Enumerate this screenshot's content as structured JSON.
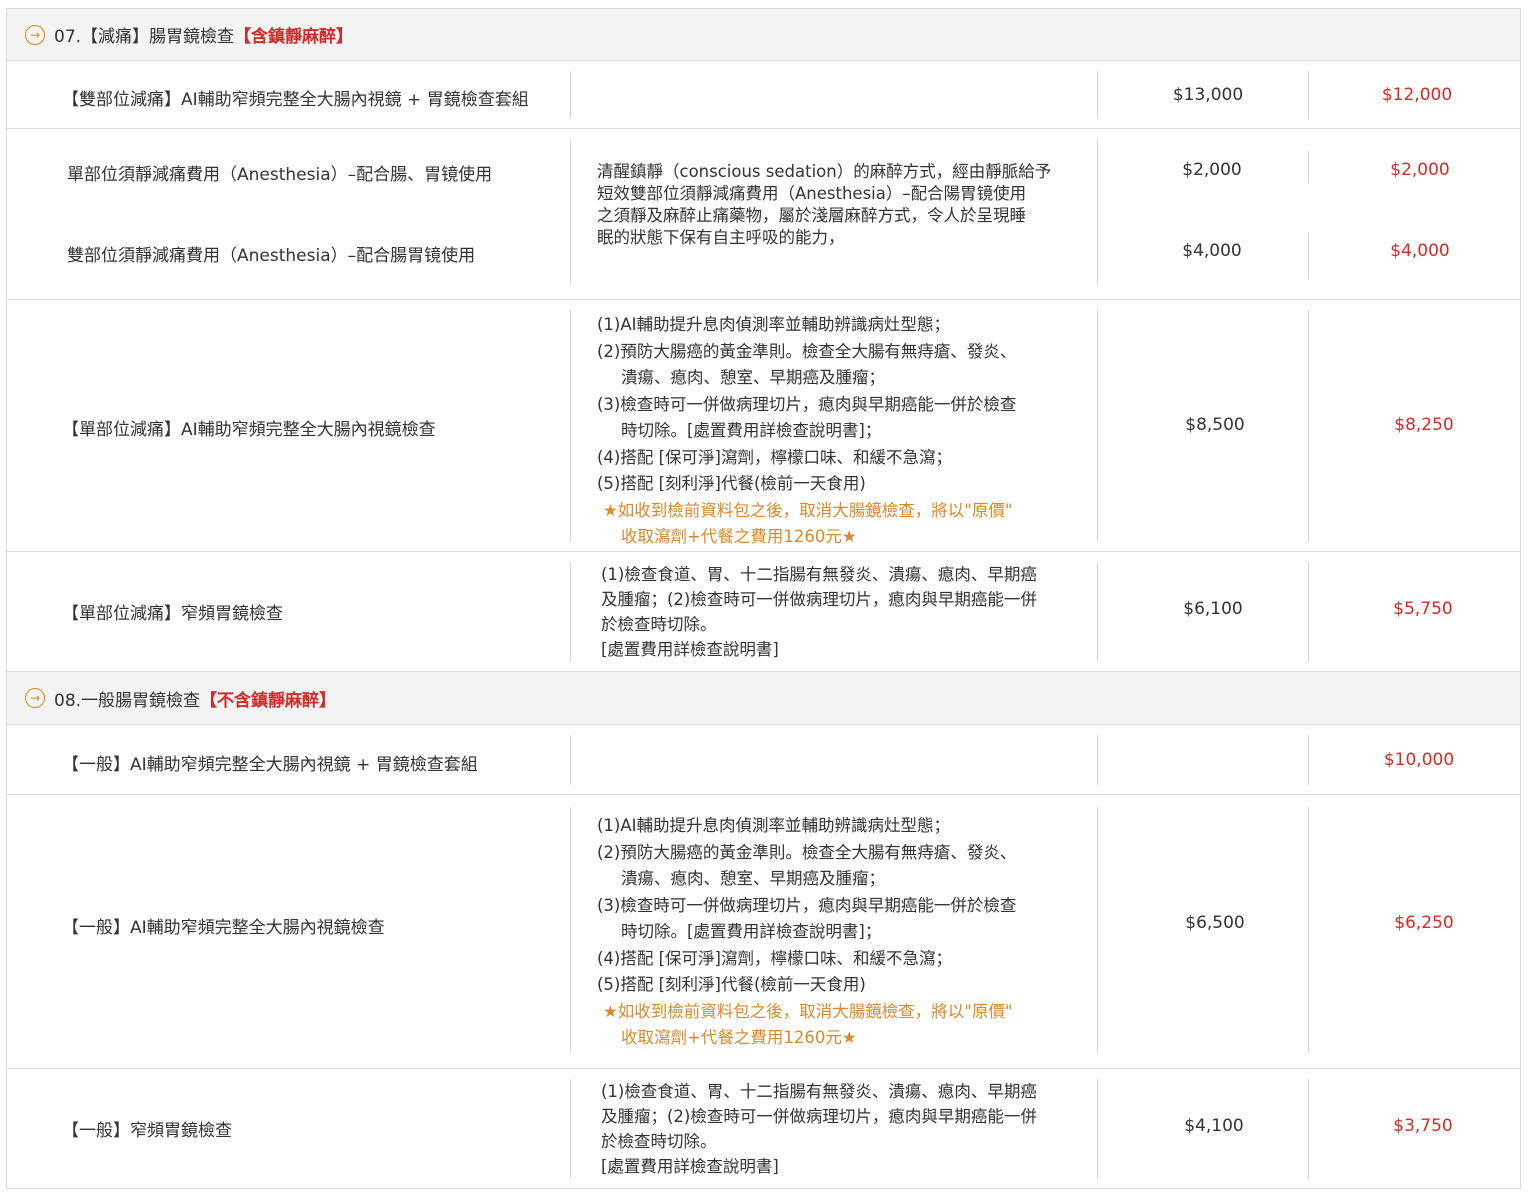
{
  "sections": [
    {
      "icon": "arrow-circle-right-icon",
      "arrow_glyph": "→",
      "title": "07.【減痛】腸胃鏡檢查",
      "highlight": "【含鎮靜麻醉】",
      "rows": [
        {
          "name": "【雙部位減痛】AI輔助窄頻完整全大腸內視鏡 + 胃鏡檢查套組",
          "price": "$13,000",
          "sale": "$12,000"
        },
        {
          "name1": "單部位須靜減痛費用（Anesthesia）–配合腸、胃镜使用",
          "name2": "雙部位須靜減痛費用（Anesthesia）–配合腸胃镜使用",
          "desc": [
            "清醒鎮靜（conscious sedation）的麻醉方式，經由靜脈給予",
            "短效雙部位須靜減痛費用（Anesthesia）–配合陽胃镜使用",
            "之須靜及麻醉止痛藥物，屬於淺層麻醉方式，令人於呈現睡",
            "眠的狀態下保有自主呼吸的能力，"
          ],
          "price1": "$2,000",
          "sale1": "$2,000",
          "price2": "$4,000",
          "sale2": "$4,000"
        },
        {
          "name": "【單部位減痛】AI輔助窄頻完整全大腸內視鏡檢查",
          "desc": [
            "(1)AI輔助提升息肉偵測率並輔助辨識病灶型態；",
            "(2)預防大腸癌的黃金準則。檢查全大腸有無痔瘡、發炎、",
            "潰瘍、瘜肉、憩室、早期癌及腫瘤；",
            "(3)檢查時可一併做病理切片，瘜肉與早期癌能一併於檢查",
            "時切除。[處置費用詳檢查說明書]；",
            "(4)搭配 [保可淨]瀉劑，檸檬口味、和緩不急瀉；",
            "(5)搭配 [刻利淨]代餐(檢前一天食用)",
            "★如收到檢前資料包之後，取消大腸鏡檢查，將以\"原價\"",
            "收取瀉劑+代餐之費用1260元★"
          ],
          "price": "$8,500",
          "sale": "$8,250"
        },
        {
          "name": "【單部位減痛】窄頻胃鏡檢查",
          "desc": [
            "(1)檢查食道、胃、十二指腸有無發炎、潰瘍、瘜肉、早期癌",
            "及腫瘤；(2)檢查時可一併做病理切片，瘜肉與早期癌能一併",
            "於檢查時切除。",
            "[處置費用詳檢查說明書]"
          ],
          "price": "$6,100",
          "sale": "$5,750"
        }
      ]
    },
    {
      "icon": "arrow-circle-right-icon",
      "arrow_glyph": "→",
      "title": "08.一般腸胃鏡檢查",
      "highlight": "【不含鎮靜麻醉】",
      "rows": [
        {
          "name": "【一般】AI輔助窄頻完整全大腸內視鏡 + 胃鏡檢查套組",
          "price": "",
          "sale": "$10,000"
        },
        {
          "name": "【一般】AI輔助窄頻完整全大腸內視鏡檢查",
          "desc": [
            "(1)AI輔助提升息肉偵測率並輔助辨識病灶型態；",
            "(2)預防大腸癌的黃金準則。檢查全大腸有無痔瘡、發炎、",
            "潰瘍、瘜肉、憩室、早期癌及腫瘤；",
            "(3)檢查時可一併做病理切片，瘜肉與早期癌能一併於檢查",
            "時切除。[處置費用詳檢查說明書]；",
            "(4)搭配 [保可淨]瀉劑，檸檬口味、和緩不急瀉；",
            "(5)搭配 [刻利淨]代餐(檢前一天食用)",
            "★如收到檢前資料包之後，取消大腸鏡檢查，將以\"原價\"",
            "收取瀉劑+代餐之費用1260元★"
          ],
          "price": "$6,500",
          "sale": "$6,250"
        },
        {
          "name": "【一般】窄頻胃鏡檢查",
          "desc": [
            "(1)檢查食道、胃、十二指腸有無發炎、潰瘍、瘜肉、早期癌",
            "及腫瘤；(2)檢查時可一併做病理切片，瘜肉與早期癌能一併",
            "於檢查時切除。",
            "[處置費用詳檢查說明書]"
          ],
          "price": "$4,100",
          "sale": "$3,750"
        }
      ]
    }
  ],
  "colors": {
    "sale": "#d62a2a",
    "note": "#d88a2c",
    "header_bg": "#f4f4f4",
    "accent": "#e08a1c"
  }
}
